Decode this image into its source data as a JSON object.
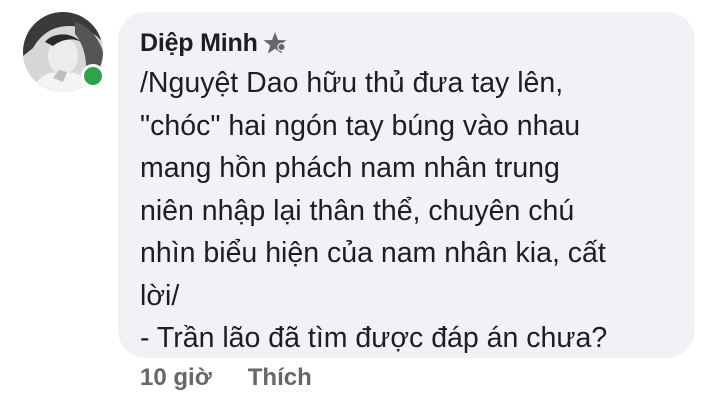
{
  "comment": {
    "author": "Diệp Minh",
    "badge_icon": "star-badge-icon",
    "lines": [
      "/Nguyệt Dao hữu thủ đưa tay lên,",
      "\"chóc\" hai ngón tay búng vào nhau",
      "mang hồn phách nam nhân trung",
      "niên nhập lại thân thể, chuyên chú",
      "nhìn biểu hiện của nam nhân kia, cất",
      "lời/",
      "- Trần lão đã tìm được đáp án chưa?"
    ],
    "timestamp": "10 giờ",
    "like_label": "Thích",
    "online_status_color": "#31a24c",
    "bubble_color": "#f0f2f5"
  }
}
